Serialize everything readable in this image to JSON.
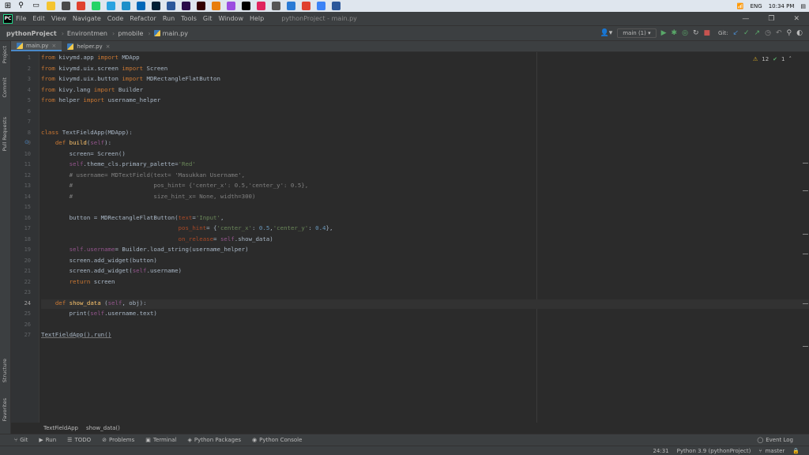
{
  "taskbar": {
    "icons": [
      {
        "name": "search-icon",
        "color": "#ffffff",
        "glyph": "⚲"
      },
      {
        "name": "taskview-icon",
        "color": "#ffffff",
        "glyph": "▭"
      },
      {
        "name": "file-explorer-icon",
        "color": "#f4c430",
        "glyph": ""
      },
      {
        "name": "calculator-icon",
        "color": "#4a4a4a",
        "glyph": ""
      },
      {
        "name": "chrome-icon",
        "color": "#e0412f",
        "glyph": ""
      },
      {
        "name": "whatsapp-icon",
        "color": "#25d366",
        "glyph": ""
      },
      {
        "name": "telegram-icon",
        "color": "#2aa3e0",
        "glyph": ""
      },
      {
        "name": "edge-icon",
        "color": "#1e90c9",
        "glyph": ""
      },
      {
        "name": "store-icon",
        "color": "#0067b8",
        "glyph": ""
      },
      {
        "name": "photoshop-icon",
        "color": "#001d34",
        "glyph": ""
      },
      {
        "name": "word-icon",
        "color": "#2b579a",
        "glyph": ""
      },
      {
        "name": "premiere-icon",
        "color": "#2a0a4a",
        "glyph": ""
      },
      {
        "name": "illustrator-icon",
        "color": "#330000",
        "glyph": ""
      },
      {
        "name": "blender-icon",
        "color": "#e87d0d",
        "glyph": ""
      },
      {
        "name": "app-icon",
        "color": "#9b4de0",
        "glyph": ""
      },
      {
        "name": "pycharm-icon",
        "color": "#000000",
        "glyph": ""
      },
      {
        "name": "app2-icon",
        "color": "#e0245e",
        "glyph": ""
      },
      {
        "name": "app3-icon",
        "color": "#555555",
        "glyph": ""
      },
      {
        "name": "app4-icon",
        "color": "#2a7ad5",
        "glyph": ""
      },
      {
        "name": "chrome2-icon",
        "color": "#e0412f",
        "glyph": ""
      },
      {
        "name": "app5-icon",
        "color": "#3b82f6",
        "glyph": ""
      },
      {
        "name": "word2-icon",
        "color": "#2b579a",
        "glyph": ""
      }
    ],
    "language": "ENG",
    "time": "10:34 PM"
  },
  "menubar": {
    "logo": "PC",
    "items": [
      "File",
      "Edit",
      "View",
      "Navigate",
      "Code",
      "Refactor",
      "Run",
      "Tools",
      "Git",
      "Window",
      "Help"
    ],
    "window_title": "pythonProject - main.py",
    "controls": [
      "—",
      "❐",
      "✕"
    ]
  },
  "navbar": {
    "project": "pythonProject",
    "crumbs": [
      "Environtmen",
      "pmobile"
    ],
    "file": "main.py",
    "run_config": "main (1)",
    "git_label": "Git:"
  },
  "tabs": [
    {
      "label": "main.py",
      "active": true
    },
    {
      "label": "helper.py",
      "active": false
    }
  ],
  "left_tools": [
    "Project",
    "Commit",
    "Pull Requests",
    "Structure",
    "Favorites"
  ],
  "inspections": {
    "warnings": "12",
    "ok": "1"
  },
  "code": {
    "current_line_index": 23,
    "lines": [
      [
        [
          "from",
          "kw"
        ],
        [
          " kivymd.app ",
          ""
        ],
        [
          "import",
          "kw"
        ],
        [
          " MDApp",
          ""
        ]
      ],
      [
        [
          "from",
          "kw"
        ],
        [
          " kivymd.uix.screen ",
          ""
        ],
        [
          "import",
          "kw"
        ],
        [
          " Screen",
          ""
        ]
      ],
      [
        [
          "from",
          "kw"
        ],
        [
          " kivymd.uix.button ",
          ""
        ],
        [
          "import",
          "kw"
        ],
        [
          " MDRectangleFlatButton",
          ""
        ]
      ],
      [
        [
          "from",
          "kw"
        ],
        [
          " kivy.lang ",
          ""
        ],
        [
          "import",
          "kw"
        ],
        [
          " Builder",
          ""
        ]
      ],
      [
        [
          "from",
          "kw"
        ],
        [
          " helper ",
          ""
        ],
        [
          "import",
          "kw"
        ],
        [
          " username_helper",
          ""
        ]
      ],
      [],
      [],
      [
        [
          "class",
          "kw"
        ],
        [
          " TextFieldApp(MDApp):",
          ""
        ]
      ],
      [
        [
          "    ",
          ""
        ],
        [
          "def",
          "kw"
        ],
        [
          " ",
          ""
        ],
        [
          "build",
          "fn"
        ],
        [
          "(",
          ""
        ],
        [
          "self",
          "self"
        ],
        [
          "):",
          ""
        ]
      ],
      [
        [
          "        screen= Screen()",
          ""
        ]
      ],
      [
        [
          "        ",
          ""
        ],
        [
          "self",
          "self"
        ],
        [
          ".theme_cls.primary_palette=",
          ""
        ],
        [
          "'Red'",
          "str"
        ]
      ],
      [
        [
          "        # username= MDTextField(text= 'Masukkan Username',",
          "cmt"
        ]
      ],
      [
        [
          "        #                       pos_hint= {'center_x': 0.5,'center_y': 0.5},",
          "cmt"
        ]
      ],
      [
        [
          "        #                       size_hint_x= None, width=300)",
          "cmt"
        ]
      ],
      [],
      [
        [
          "        button = MDRectangleFlatButton(",
          ""
        ],
        [
          "text",
          "param"
        ],
        [
          "=",
          ""
        ],
        [
          "'Input'",
          "str"
        ],
        [
          ",",
          ""
        ]
      ],
      [
        [
          "                                       ",
          ""
        ],
        [
          "pos_hint",
          "param"
        ],
        [
          "=",
          ""
        ],
        [
          " {",
          ""
        ],
        [
          "'center_x'",
          "str"
        ],
        [
          ": ",
          ""
        ],
        [
          "0.5",
          "num"
        ],
        [
          ",",
          ""
        ],
        [
          "'center_y'",
          "str"
        ],
        [
          ": ",
          ""
        ],
        [
          "0.4",
          "num"
        ],
        [
          "},",
          ""
        ]
      ],
      [
        [
          "                                       ",
          ""
        ],
        [
          "on_release",
          "param"
        ],
        [
          "=",
          ""
        ],
        [
          " ",
          ""
        ],
        [
          "self",
          "self"
        ],
        [
          ".show_data)",
          ""
        ]
      ],
      [
        [
          "        ",
          ""
        ],
        [
          "self.username",
          "self"
        ],
        [
          "= Builder.load_string(username_helper)",
          ""
        ]
      ],
      [
        [
          "        screen.add_widget(button)",
          ""
        ]
      ],
      [
        [
          "        screen.add_widget(",
          ""
        ],
        [
          "self",
          "self"
        ],
        [
          ".username)",
          ""
        ]
      ],
      [
        [
          "        ",
          ""
        ],
        [
          "return",
          "kw"
        ],
        [
          " screen",
          ""
        ]
      ],
      [],
      [
        [
          "    ",
          ""
        ],
        [
          "def",
          "kw"
        ],
        [
          " ",
          ""
        ],
        [
          "show_data",
          "fn"
        ],
        [
          " (",
          ""
        ],
        [
          "self",
          "self"
        ],
        [
          ", obj):",
          ""
        ]
      ],
      [
        [
          "        print(",
          ""
        ],
        [
          "self",
          "self"
        ],
        [
          ".username.text)",
          ""
        ]
      ],
      [],
      [
        [
          "TextFieldApp().run()",
          "uline"
        ]
      ]
    ]
  },
  "editor_breadcrumb": [
    "TextFieldApp",
    "show_data()"
  ],
  "bottom_tools": [
    {
      "icon": "git-icon",
      "glyph": "⑂",
      "label": "Git"
    },
    {
      "icon": "run-icon",
      "glyph": "▶",
      "label": "Run"
    },
    {
      "icon": "todo-icon",
      "glyph": "☰",
      "label": "TODO"
    },
    {
      "icon": "problems-icon",
      "glyph": "⊘",
      "label": "Problems"
    },
    {
      "icon": "terminal-icon",
      "glyph": "▣",
      "label": "Terminal"
    },
    {
      "icon": "packages-icon",
      "glyph": "◈",
      "label": "Python Packages"
    },
    {
      "icon": "python-console-icon",
      "glyph": "◉",
      "label": "Python Console"
    }
  ],
  "event_log": "Event Log",
  "status": {
    "position": "24:31",
    "interpreter": "Python 3.9 (pythonProject)",
    "branch": "master"
  }
}
